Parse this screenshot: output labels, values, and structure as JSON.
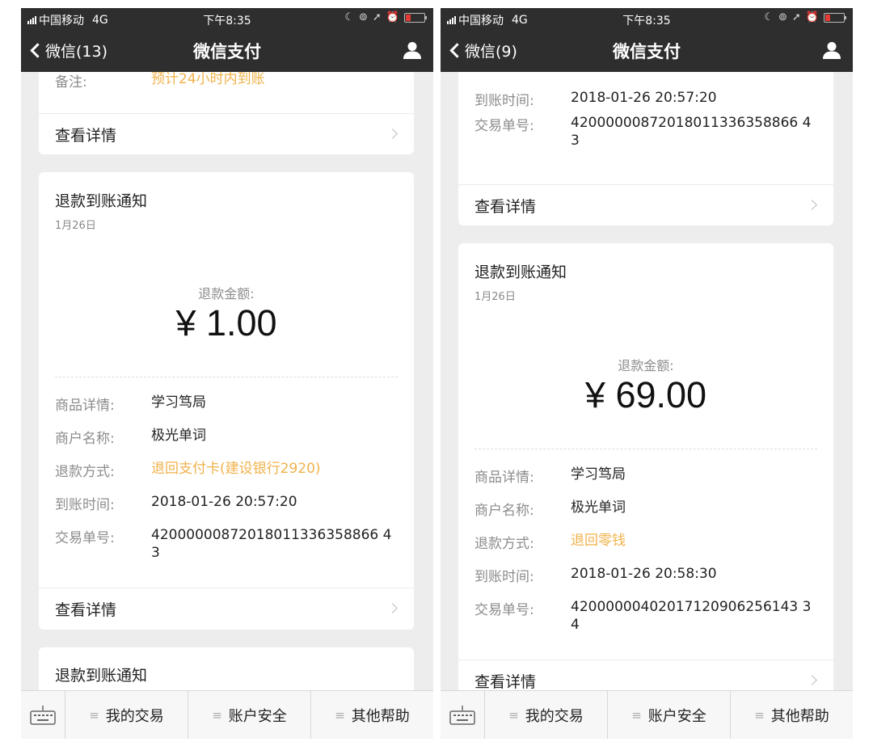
{
  "status_bar": {
    "carrier": "中国移动",
    "network": "4G",
    "time": "下午8:35"
  },
  "left": {
    "nav": {
      "back": "微信(13)",
      "title": "微信支付"
    },
    "top_card": {
      "remark_key": "备注:",
      "remark_value": "预计24小时内到账",
      "detail_link": "查看详情"
    },
    "notice": {
      "title": "退款到账通知",
      "date": "1月26日",
      "amount_label": "退款金额:",
      "amount": "¥ 1.00",
      "rows": [
        {
          "key": "商品详情:",
          "value": "学习笃局"
        },
        {
          "key": "商户名称:",
          "value": "极光单词"
        },
        {
          "key": "退款方式:",
          "value": "退回支付卡(建设银行2920)"
        },
        {
          "key": "到账时间:",
          "value": "2018-01-26 20:57:20"
        },
        {
          "key": "交易单号:",
          "value": "42000000872018011336358866 43"
        }
      ],
      "detail_link": "查看详情"
    },
    "next_card_title": "退款到账通知"
  },
  "right": {
    "nav": {
      "back": "微信(9)",
      "title": "微信支付"
    },
    "top_card": {
      "rows": [
        {
          "key": "到账时间:",
          "value": "2018-01-26 20:57:20"
        },
        {
          "key": "交易单号:",
          "value": "42000000872018011336358866 43"
        }
      ],
      "detail_link": "查看详情"
    },
    "notice": {
      "title": "退款到账通知",
      "date": "1月26日",
      "amount_label": "退款金额:",
      "amount": "¥ 69.00",
      "rows": [
        {
          "key": "商品详情:",
          "value": "学习笃局"
        },
        {
          "key": "商户名称:",
          "value": "极光单词"
        },
        {
          "key": "退款方式:",
          "value": "退回零钱"
        },
        {
          "key": "到账时间:",
          "value": "2018-01-26 20:58:30"
        },
        {
          "key": "交易单号:",
          "value": "42000000402017120906256143 34"
        }
      ],
      "detail_link": "查看详情"
    }
  },
  "bottom_menu": {
    "items": [
      "我的交易",
      "账户安全",
      "其他帮助"
    ]
  },
  "colors": {
    "bar_bg": "#2e2e2e",
    "page_bg": "#ededed",
    "highlight": "#f0b24b",
    "battery": "#e53935"
  },
  "icons": [
    "signal-icon",
    "moon-icon",
    "lock-rotation-icon",
    "location-icon",
    "alarm-icon",
    "battery-icon",
    "back-chevron-icon",
    "person-icon",
    "keyboard-icon",
    "menu-icon",
    "chevron-right-icon"
  ]
}
